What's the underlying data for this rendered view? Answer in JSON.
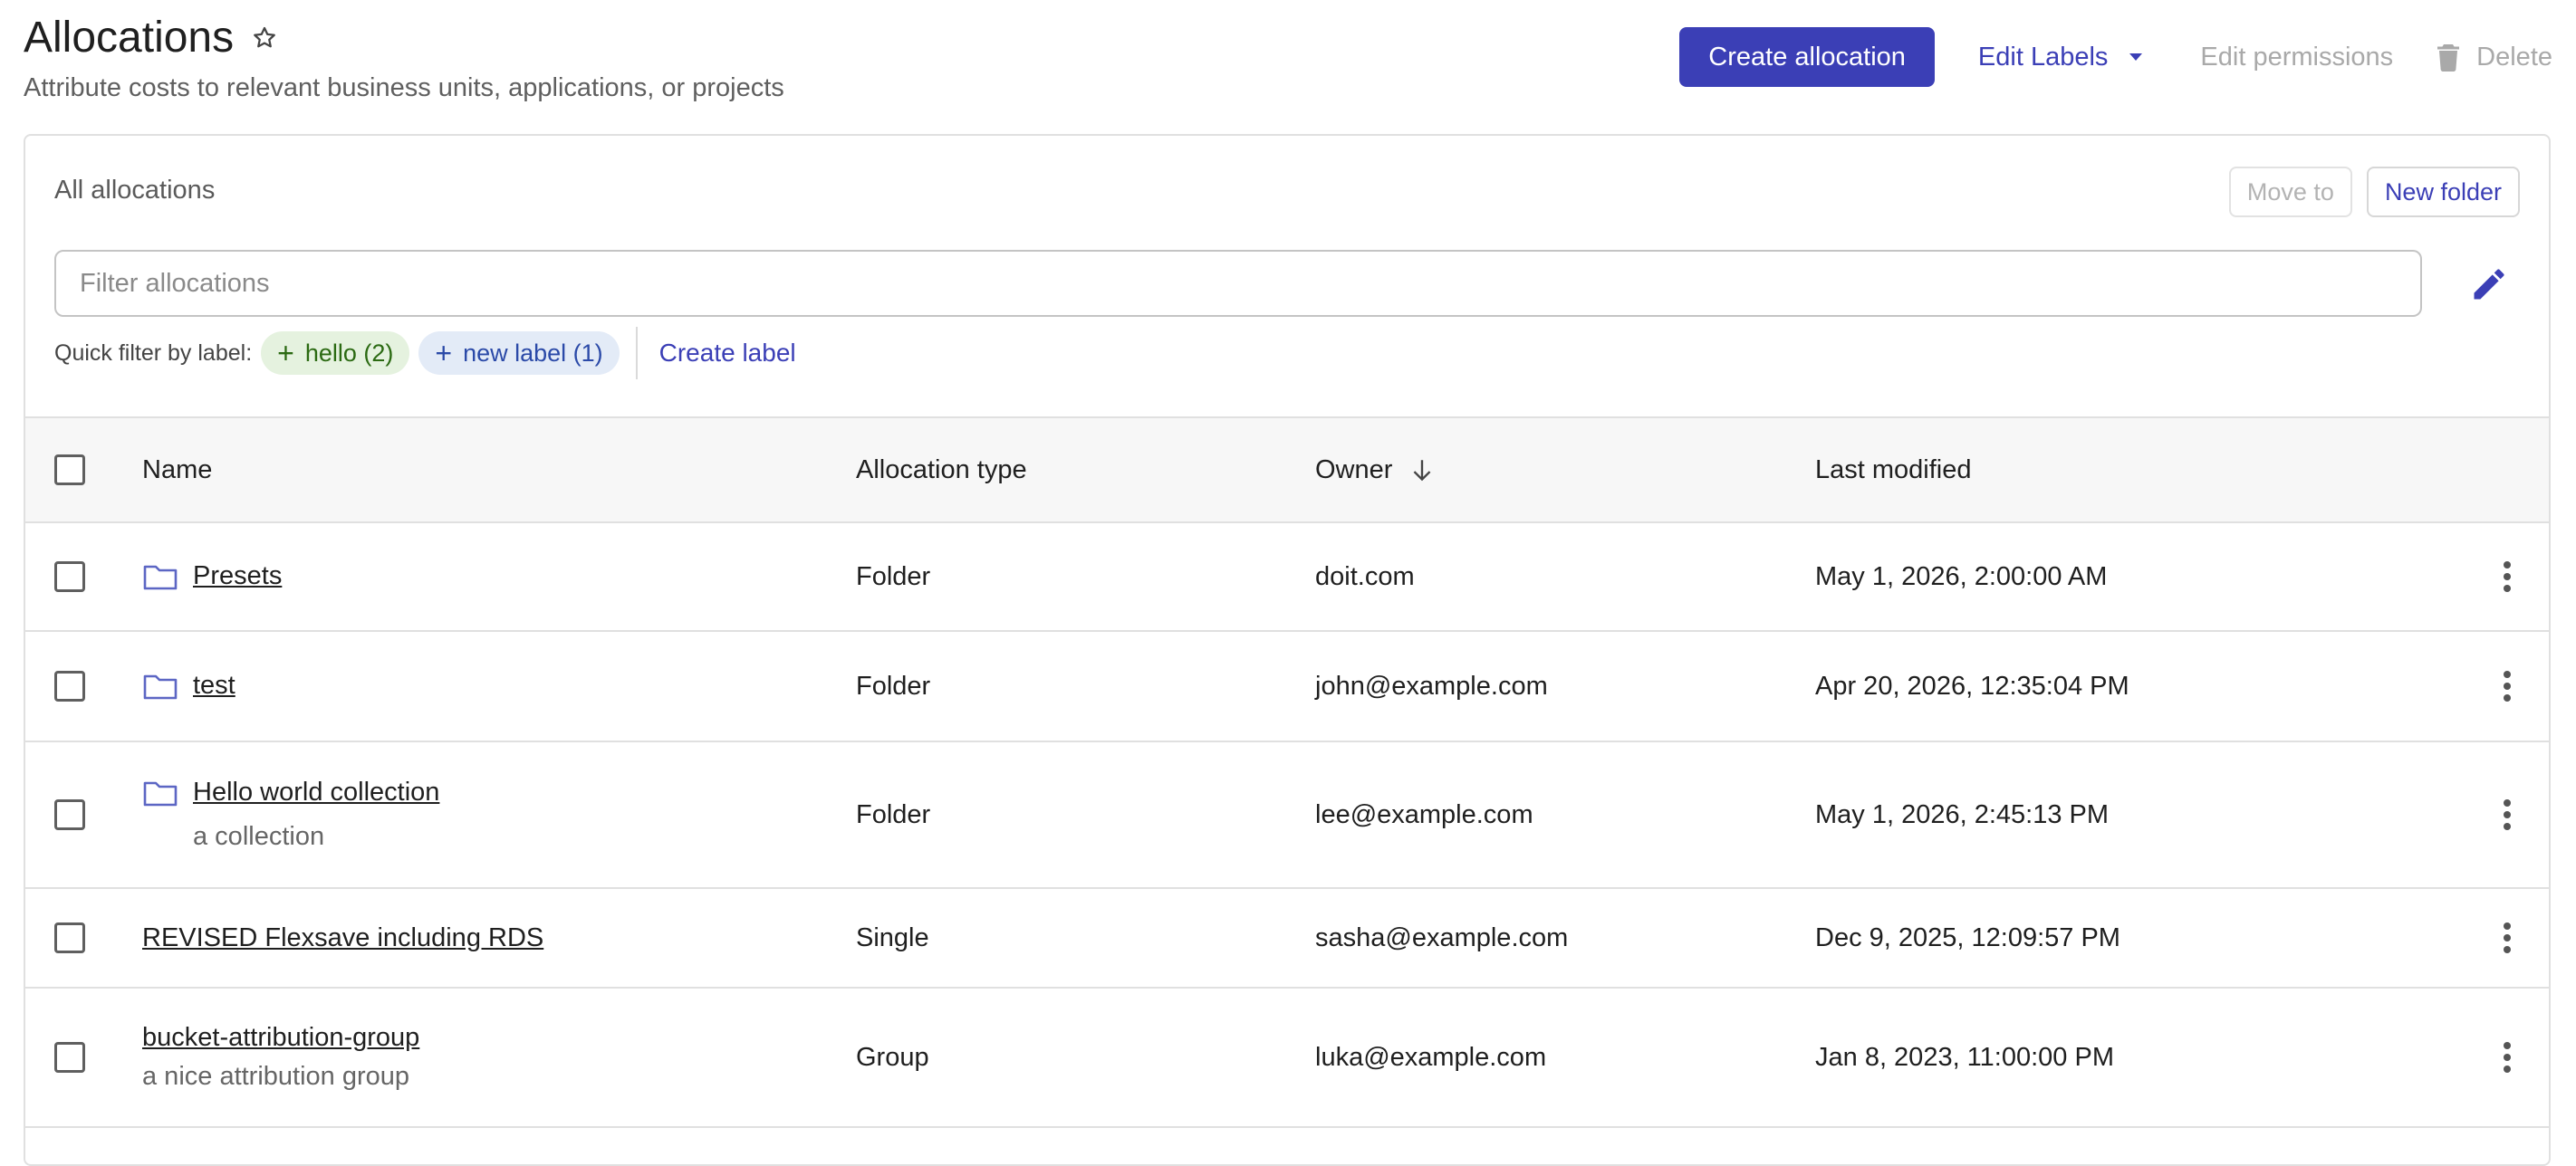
{
  "header": {
    "title": "Allocations",
    "subtitle": "Attribute costs to relevant business units, applications, or projects",
    "create_label": "Create allocation",
    "edit_labels_label": "Edit Labels",
    "edit_permissions_label": "Edit permissions",
    "delete_label": "Delete"
  },
  "panel": {
    "breadcrumb": "All allocations",
    "move_to_label": "Move to",
    "new_folder_label": "New folder",
    "filter_placeholder": "Filter allocations",
    "quick_filter_label": "Quick filter by label:",
    "chips": [
      {
        "label": "hello (2)"
      },
      {
        "label": "new label (1)"
      }
    ],
    "create_label_link": "Create label"
  },
  "table": {
    "columns": {
      "name": "Name",
      "type": "Allocation type",
      "owner": "Owner",
      "modified": "Last modified"
    },
    "rows": [
      {
        "name": "Presets",
        "description": "",
        "type": "Folder",
        "owner": "doit.com",
        "modified": "May 1, 2026, 2:00:00 AM",
        "folder": true
      },
      {
        "name": "test",
        "description": "",
        "type": "Folder",
        "owner": "john@example.com",
        "modified": "Apr 20, 2026, 12:35:04 PM",
        "folder": true
      },
      {
        "name": "Hello world collection",
        "description": "a collection",
        "type": "Folder",
        "owner": "lee@example.com",
        "modified": "May 1, 2026, 2:45:13 PM",
        "folder": true
      },
      {
        "name": "REVISED Flexsave including RDS",
        "description": "",
        "type": "Single",
        "owner": "sasha@example.com",
        "modified": "Dec 9, 2025, 12:09:57 PM",
        "folder": false
      },
      {
        "name": "bucket-attribution-group",
        "description": "a nice attribution group",
        "type": "Group",
        "owner": "luka@example.com",
        "modified": "Jan 8, 2023, 11:00:00 PM",
        "folder": false
      }
    ]
  },
  "colors": {
    "accent": "#3b3fb6",
    "folder_icon": "#5c66c4"
  },
  "icons": {
    "star": "star-outline-icon",
    "caret": "caret-down-icon",
    "trash": "trash-icon",
    "edit": "pencil-icon",
    "sort": "arrow-down-icon",
    "folder": "folder-icon",
    "menu": "more-vertical-icon"
  }
}
